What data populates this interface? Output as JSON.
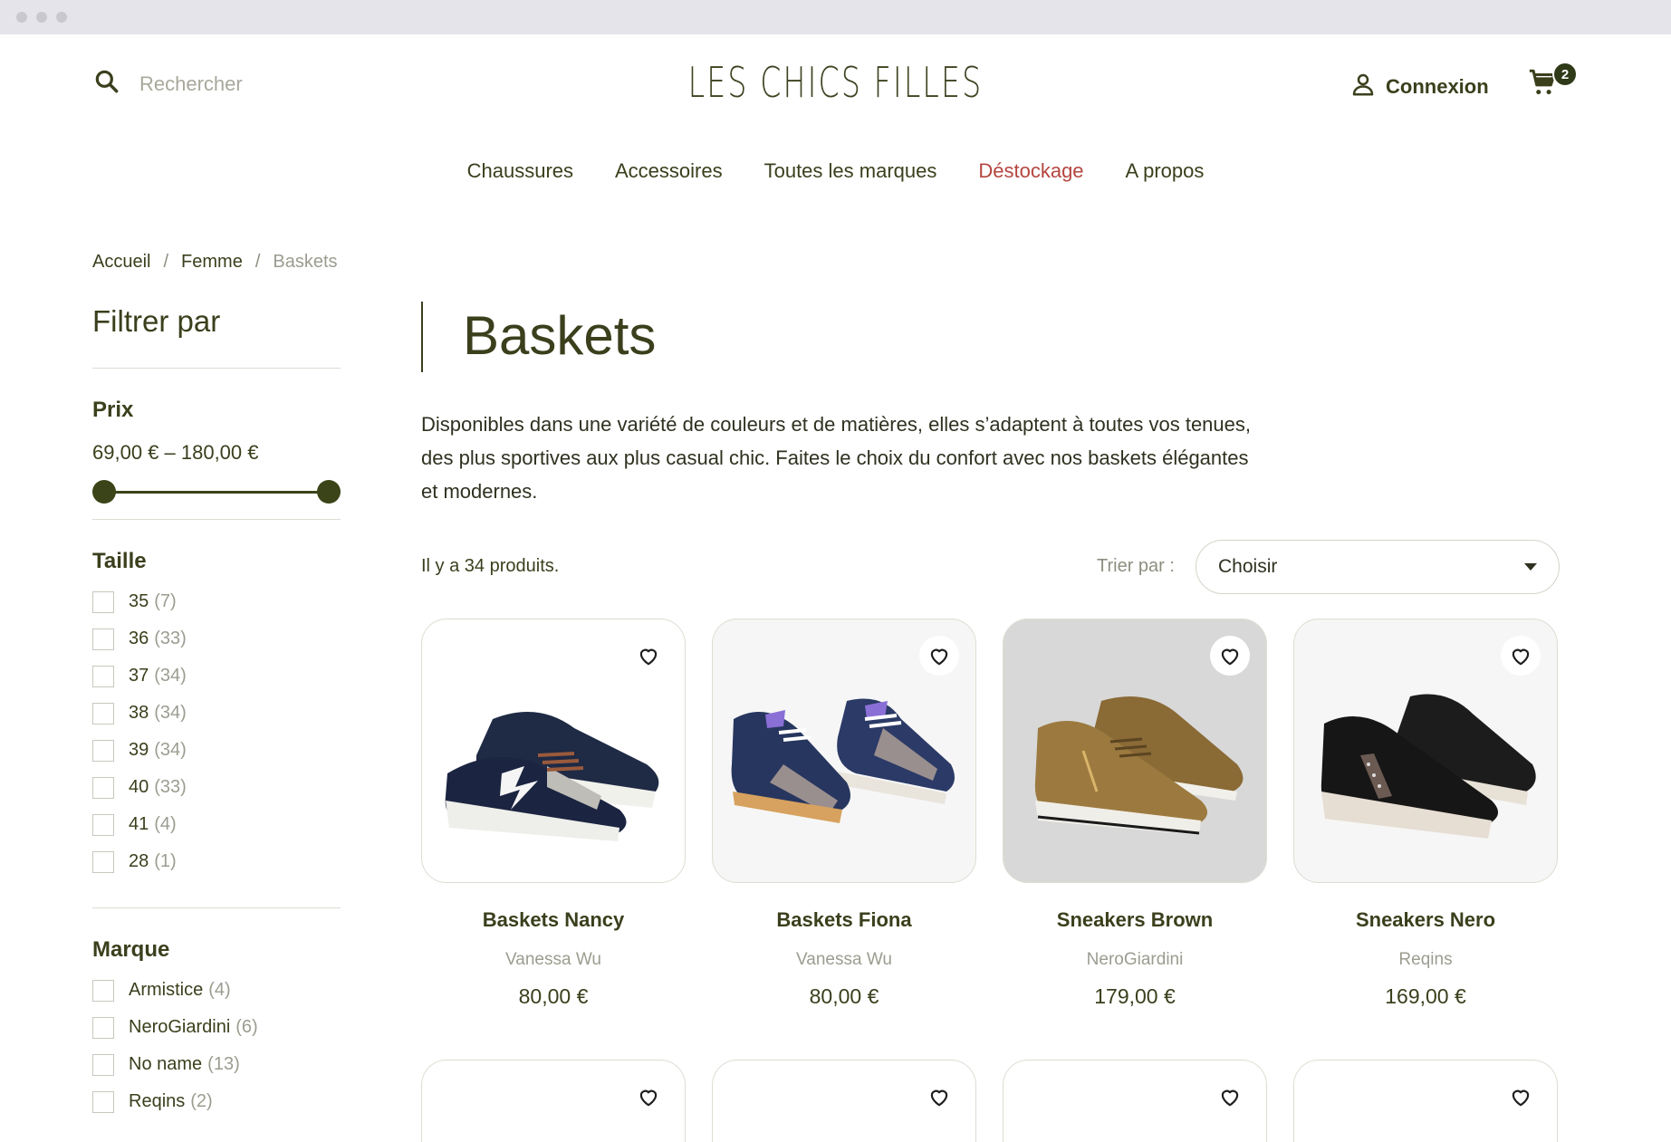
{
  "header": {
    "search_placeholder": "Rechercher",
    "logo": "LES CHICS FILLES",
    "account_label": "Connexion",
    "cart_count": "2"
  },
  "nav": [
    "Chaussures",
    "Accessoires",
    "Toutes les marques",
    "Déstockage",
    "A propos"
  ],
  "breadcrumb": [
    "Accueil",
    "Femme",
    "Baskets"
  ],
  "breadcrumb_separator": "/",
  "sidebar": {
    "title": "Filtrer par",
    "price": {
      "title": "Prix",
      "range": "69,00 € – 180,00 €",
      "min_fraction": 0.0,
      "max_fraction": 1.0
    },
    "size": {
      "title": "Taille",
      "options": [
        {
          "label": "35",
          "count": "(7)"
        },
        {
          "label": "36",
          "count": "(33)"
        },
        {
          "label": "37",
          "count": "(34)"
        },
        {
          "label": "38",
          "count": "(34)"
        },
        {
          "label": "39",
          "count": "(34)"
        },
        {
          "label": "40",
          "count": "(33)"
        },
        {
          "label": "41",
          "count": "(4)"
        },
        {
          "label": "28",
          "count": "(1)"
        }
      ]
    },
    "brand": {
      "title": "Marque",
      "options": [
        {
          "label": "Armistice",
          "count": "(4)"
        },
        {
          "label": "NeroGiardini",
          "count": "(6)"
        },
        {
          "label": "No name",
          "count": "(13)"
        },
        {
          "label": "Reqins",
          "count": "(2)"
        }
      ]
    }
  },
  "main": {
    "title": "Baskets",
    "description": "Disponibles dans une variété de couleurs et de matières, elles s’adaptent à toutes vos tenues, des plus sportives aux plus casual chic. Faites le choix du confort avec nos baskets élégantes et modernes.",
    "product_count": "Il y a 34 produits.",
    "sort_label": "Trier par :",
    "sort_value": "Choisir"
  },
  "products": [
    {
      "name": "Baskets Nancy",
      "brand": "Vanessa Wu",
      "price": "80,00 €"
    },
    {
      "name": "Baskets Fiona",
      "brand": "Vanessa Wu",
      "price": "80,00 €"
    },
    {
      "name": "Sneakers Brown",
      "brand": "NeroGiardini",
      "price": "179,00 €"
    },
    {
      "name": "Sneakers Nero",
      "brand": "Reqins",
      "price": "169,00 €"
    }
  ],
  "colors": {
    "text": "#3b3f1c",
    "accent": "#3b4418",
    "sale": "#b4453f",
    "muted": "#9c9c90"
  }
}
